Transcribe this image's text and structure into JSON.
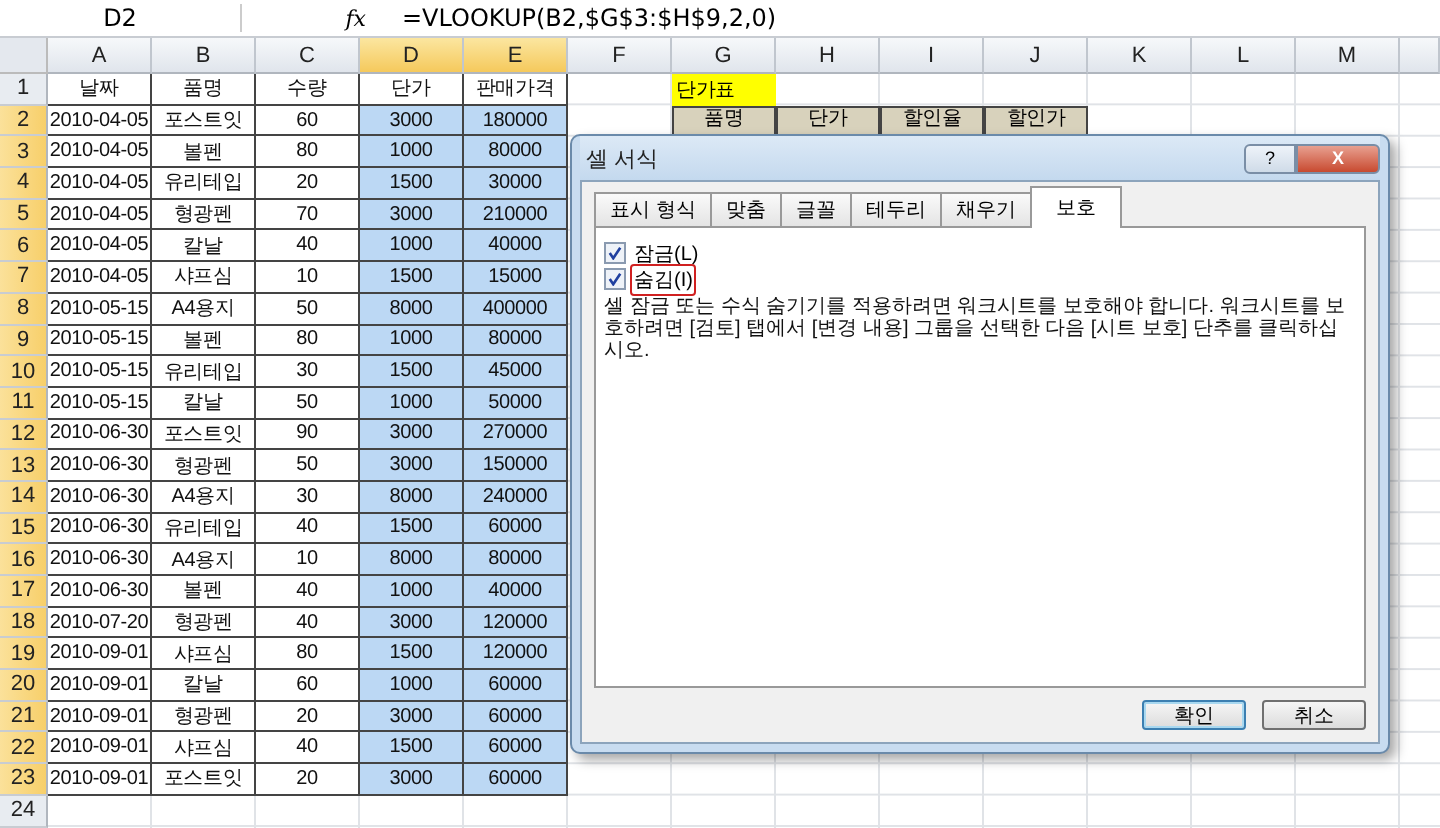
{
  "formula_bar": {
    "name_box": "D2",
    "fx": "fx",
    "formula": "=VLOOKUP(B2,$G$3:$H$9,2,0)"
  },
  "sheet": {
    "columns": [
      {
        "label": "A",
        "selected": false
      },
      {
        "label": "B",
        "selected": false
      },
      {
        "label": "C",
        "selected": false
      },
      {
        "label": "D",
        "selected": true
      },
      {
        "label": "E",
        "selected": true
      },
      {
        "label": "F",
        "selected": false
      },
      {
        "label": "G",
        "selected": false
      },
      {
        "label": "H",
        "selected": false
      },
      {
        "label": "I",
        "selected": false
      },
      {
        "label": "J",
        "selected": false
      },
      {
        "label": "K",
        "selected": false
      },
      {
        "label": "L",
        "selected": false
      },
      {
        "label": "M",
        "selected": false
      }
    ],
    "rows": [
      {
        "number": "1",
        "selected": false,
        "cells": [
          "날짜",
          "품명",
          "수량",
          "단가",
          "판매가격"
        ]
      },
      {
        "number": "2",
        "selected": true,
        "cells": [
          "2010-04-05",
          "포스트잇",
          "60",
          "3000",
          "180000"
        ]
      },
      {
        "number": "3",
        "selected": true,
        "cells": [
          "2010-04-05",
          "볼펜",
          "80",
          "1000",
          "80000"
        ]
      },
      {
        "number": "4",
        "selected": true,
        "cells": [
          "2010-04-05",
          "유리테입",
          "20",
          "1500",
          "30000"
        ]
      },
      {
        "number": "5",
        "selected": true,
        "cells": [
          "2010-04-05",
          "형광펜",
          "70",
          "3000",
          "210000"
        ]
      },
      {
        "number": "6",
        "selected": true,
        "cells": [
          "2010-04-05",
          "칼날",
          "40",
          "1000",
          "40000"
        ]
      },
      {
        "number": "7",
        "selected": true,
        "cells": [
          "2010-04-05",
          "샤프심",
          "10",
          "1500",
          "15000"
        ]
      },
      {
        "number": "8",
        "selected": true,
        "cells": [
          "2010-05-15",
          "A4용지",
          "50",
          "8000",
          "400000"
        ]
      },
      {
        "number": "9",
        "selected": true,
        "cells": [
          "2010-05-15",
          "볼펜",
          "80",
          "1000",
          "80000"
        ]
      },
      {
        "number": "10",
        "selected": true,
        "cells": [
          "2010-05-15",
          "유리테입",
          "30",
          "1500",
          "45000"
        ]
      },
      {
        "number": "11",
        "selected": true,
        "cells": [
          "2010-05-15",
          "칼날",
          "50",
          "1000",
          "50000"
        ]
      },
      {
        "number": "12",
        "selected": true,
        "cells": [
          "2010-06-30",
          "포스트잇",
          "90",
          "3000",
          "270000"
        ]
      },
      {
        "number": "13",
        "selected": true,
        "cells": [
          "2010-06-30",
          "형광펜",
          "50",
          "3000",
          "150000"
        ]
      },
      {
        "number": "14",
        "selected": true,
        "cells": [
          "2010-06-30",
          "A4용지",
          "30",
          "8000",
          "240000"
        ]
      },
      {
        "number": "15",
        "selected": true,
        "cells": [
          "2010-06-30",
          "유리테입",
          "40",
          "1500",
          "60000"
        ]
      },
      {
        "number": "16",
        "selected": true,
        "cells": [
          "2010-06-30",
          "A4용지",
          "10",
          "8000",
          "80000"
        ]
      },
      {
        "number": "17",
        "selected": true,
        "cells": [
          "2010-06-30",
          "볼펜",
          "40",
          "1000",
          "40000"
        ]
      },
      {
        "number": "18",
        "selected": true,
        "cells": [
          "2010-07-20",
          "형광펜",
          "40",
          "3000",
          "120000"
        ]
      },
      {
        "number": "19",
        "selected": true,
        "cells": [
          "2010-09-01",
          "샤프심",
          "80",
          "1500",
          "120000"
        ]
      },
      {
        "number": "20",
        "selected": true,
        "cells": [
          "2010-09-01",
          "칼날",
          "60",
          "1000",
          "60000"
        ]
      },
      {
        "number": "21",
        "selected": true,
        "cells": [
          "2010-09-01",
          "형광펜",
          "20",
          "3000",
          "60000"
        ]
      },
      {
        "number": "22",
        "selected": true,
        "cells": [
          "2010-09-01",
          "샤프심",
          "40",
          "1500",
          "60000"
        ]
      },
      {
        "number": "23",
        "selected": true,
        "cells": [
          "2010-09-01",
          "포스트잇",
          "20",
          "3000",
          "60000"
        ]
      },
      {
        "number": "24",
        "selected": false,
        "cells": []
      }
    ],
    "price_table": {
      "title": "단가표",
      "columns": [
        "품명",
        "단가",
        "할인율",
        "할인가"
      ]
    }
  },
  "dialog": {
    "title": "셀 서식",
    "help": "?",
    "close": "X",
    "tabs": [
      {
        "label": "표시 형식",
        "selected": false
      },
      {
        "label": "맞춤",
        "selected": false
      },
      {
        "label": "글꼴",
        "selected": false
      },
      {
        "label": "테두리",
        "selected": false
      },
      {
        "label": "채우기",
        "selected": false
      },
      {
        "label": "보호",
        "selected": true
      }
    ],
    "options": [
      {
        "label": "잠금(L)",
        "checked": true,
        "highlighted": false
      },
      {
        "label": "숨김(I)",
        "checked": true,
        "highlighted": true
      }
    ],
    "description": "셀 잠금 또는 수식 숨기기를 적용하려면 워크시트를 보호해야 합니다. 워크시트를 보호하려면 [검토] 탭에서 [변경 내용] 그룹을 선택한 다음 [시트 보호] 단추를 클릭하십시오.",
    "buttons": [
      {
        "label": "확인",
        "default": true
      },
      {
        "label": "취소",
        "default": false
      }
    ]
  }
}
